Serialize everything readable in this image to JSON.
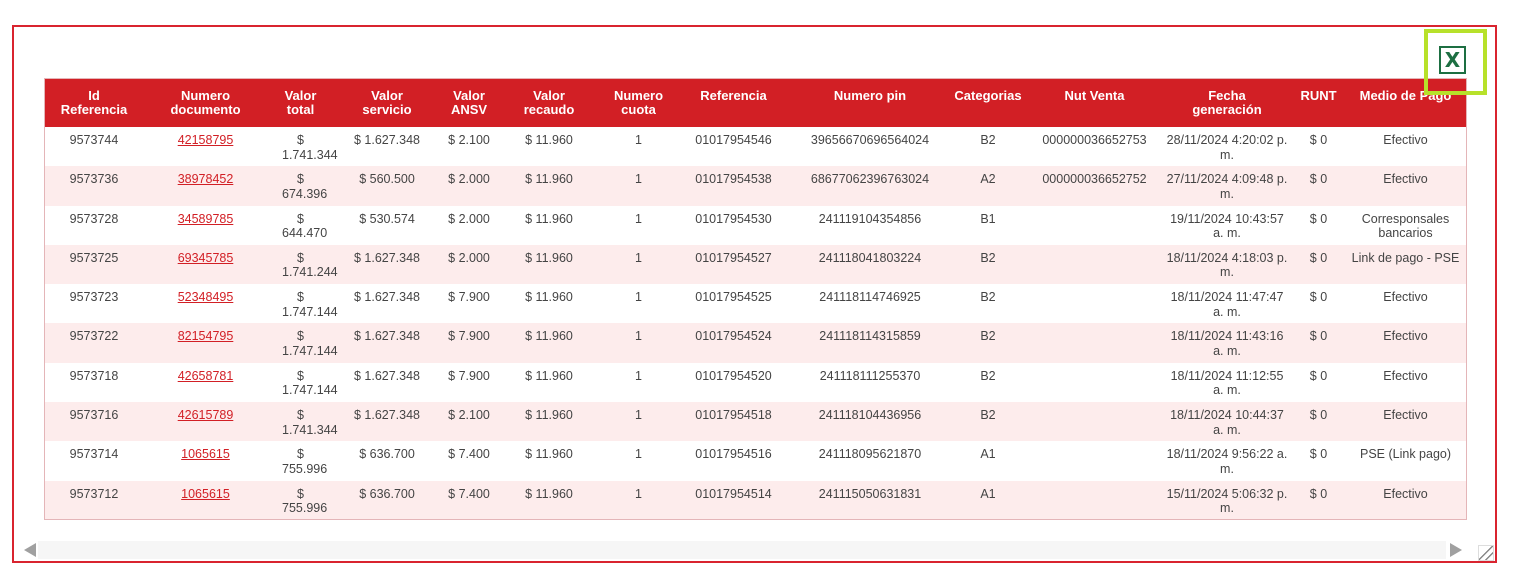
{
  "export": {
    "icon_label": "X"
  },
  "table": {
    "headers": [
      "Id\nReferencia",
      "Numero\ndocumento",
      "Valor\ntotal",
      "Valor\nservicio",
      "Valor\nANSV",
      "Valor\nrecaudo",
      "Numero\ncuota",
      "Referencia",
      "Numero pin",
      "Categorias",
      "Nut Venta",
      "Fecha\ngeneración",
      "RUNT",
      "Medio de Pago"
    ],
    "rows": [
      [
        "9573744",
        "42158795",
        "$ 1.741.344",
        "$ 1.627.348",
        "$ 2.100",
        "$ 11.960",
        "1",
        "01017954546",
        "39656670696564024",
        "B2",
        "000000036652753",
        "28/11/2024 4:20:02 p. m.",
        "$ 0",
        "Efectivo"
      ],
      [
        "9573736",
        "38978452",
        "$ 674.396",
        "$ 560.500",
        "$ 2.000",
        "$ 11.960",
        "1",
        "01017954538",
        "68677062396763024",
        "A2",
        "000000036652752",
        "27/11/2024 4:09:48 p. m.",
        "$ 0",
        "Efectivo"
      ],
      [
        "9573728",
        "34589785",
        "$ 644.470",
        "$ 530.574",
        "$ 2.000",
        "$ 11.960",
        "1",
        "01017954530",
        "241119104354856",
        "B1",
        "",
        "19/11/2024 10:43:57 a. m.",
        "$ 0",
        "Corresponsales bancarios"
      ],
      [
        "9573725",
        "69345785",
        "$ 1.741.244",
        "$ 1.627.348",
        "$ 2.000",
        "$ 11.960",
        "1",
        "01017954527",
        "241118041803224",
        "B2",
        "",
        "18/11/2024 4:18:03 p. m.",
        "$ 0",
        "Link de pago - PSE"
      ],
      [
        "9573723",
        "52348495",
        "$ 1.747.144",
        "$ 1.627.348",
        "$ 7.900",
        "$ 11.960",
        "1",
        "01017954525",
        "241118114746925",
        "B2",
        "",
        "18/11/2024 11:47:47 a. m.",
        "$ 0",
        "Efectivo"
      ],
      [
        "9573722",
        "82154795",
        "$ 1.747.144",
        "$ 1.627.348",
        "$ 7.900",
        "$ 11.960",
        "1",
        "01017954524",
        "241118114315859",
        "B2",
        "",
        "18/11/2024 11:43:16 a. m.",
        "$ 0",
        "Efectivo"
      ],
      [
        "9573718",
        "42658781",
        "$ 1.747.144",
        "$ 1.627.348",
        "$ 7.900",
        "$ 11.960",
        "1",
        "01017954520",
        "241118111255370",
        "B2",
        "",
        "18/11/2024 11:12:55 a. m.",
        "$ 0",
        "Efectivo"
      ],
      [
        "9573716",
        "42615789",
        "$ 1.741.344",
        "$ 1.627.348",
        "$ 2.100",
        "$ 11.960",
        "1",
        "01017954518",
        "241118104436956",
        "B2",
        "",
        "18/11/2024 10:44:37 a. m.",
        "$ 0",
        "Efectivo"
      ],
      [
        "9573714",
        "1065615",
        "$ 755.996",
        "$ 636.700",
        "$ 7.400",
        "$ 11.960",
        "1",
        "01017954516",
        "241118095621870",
        "A1",
        "",
        "18/11/2024 9:56:22 a. m.",
        "$ 0",
        "PSE (Link pago)"
      ],
      [
        "9573712",
        "1065615",
        "$ 755.996",
        "$ 636.700",
        "$ 7.400",
        "$ 11.960",
        "1",
        "01017954514",
        "241115050631831",
        "A1",
        "",
        "15/11/2024 5:06:32 p. m.",
        "$ 0",
        "Efectivo"
      ]
    ]
  },
  "colors": {
    "header_bg": "#d21f25",
    "frame_border": "#d9242f",
    "highlight": "#b7e12a",
    "excel_green": "#1d6f42"
  }
}
